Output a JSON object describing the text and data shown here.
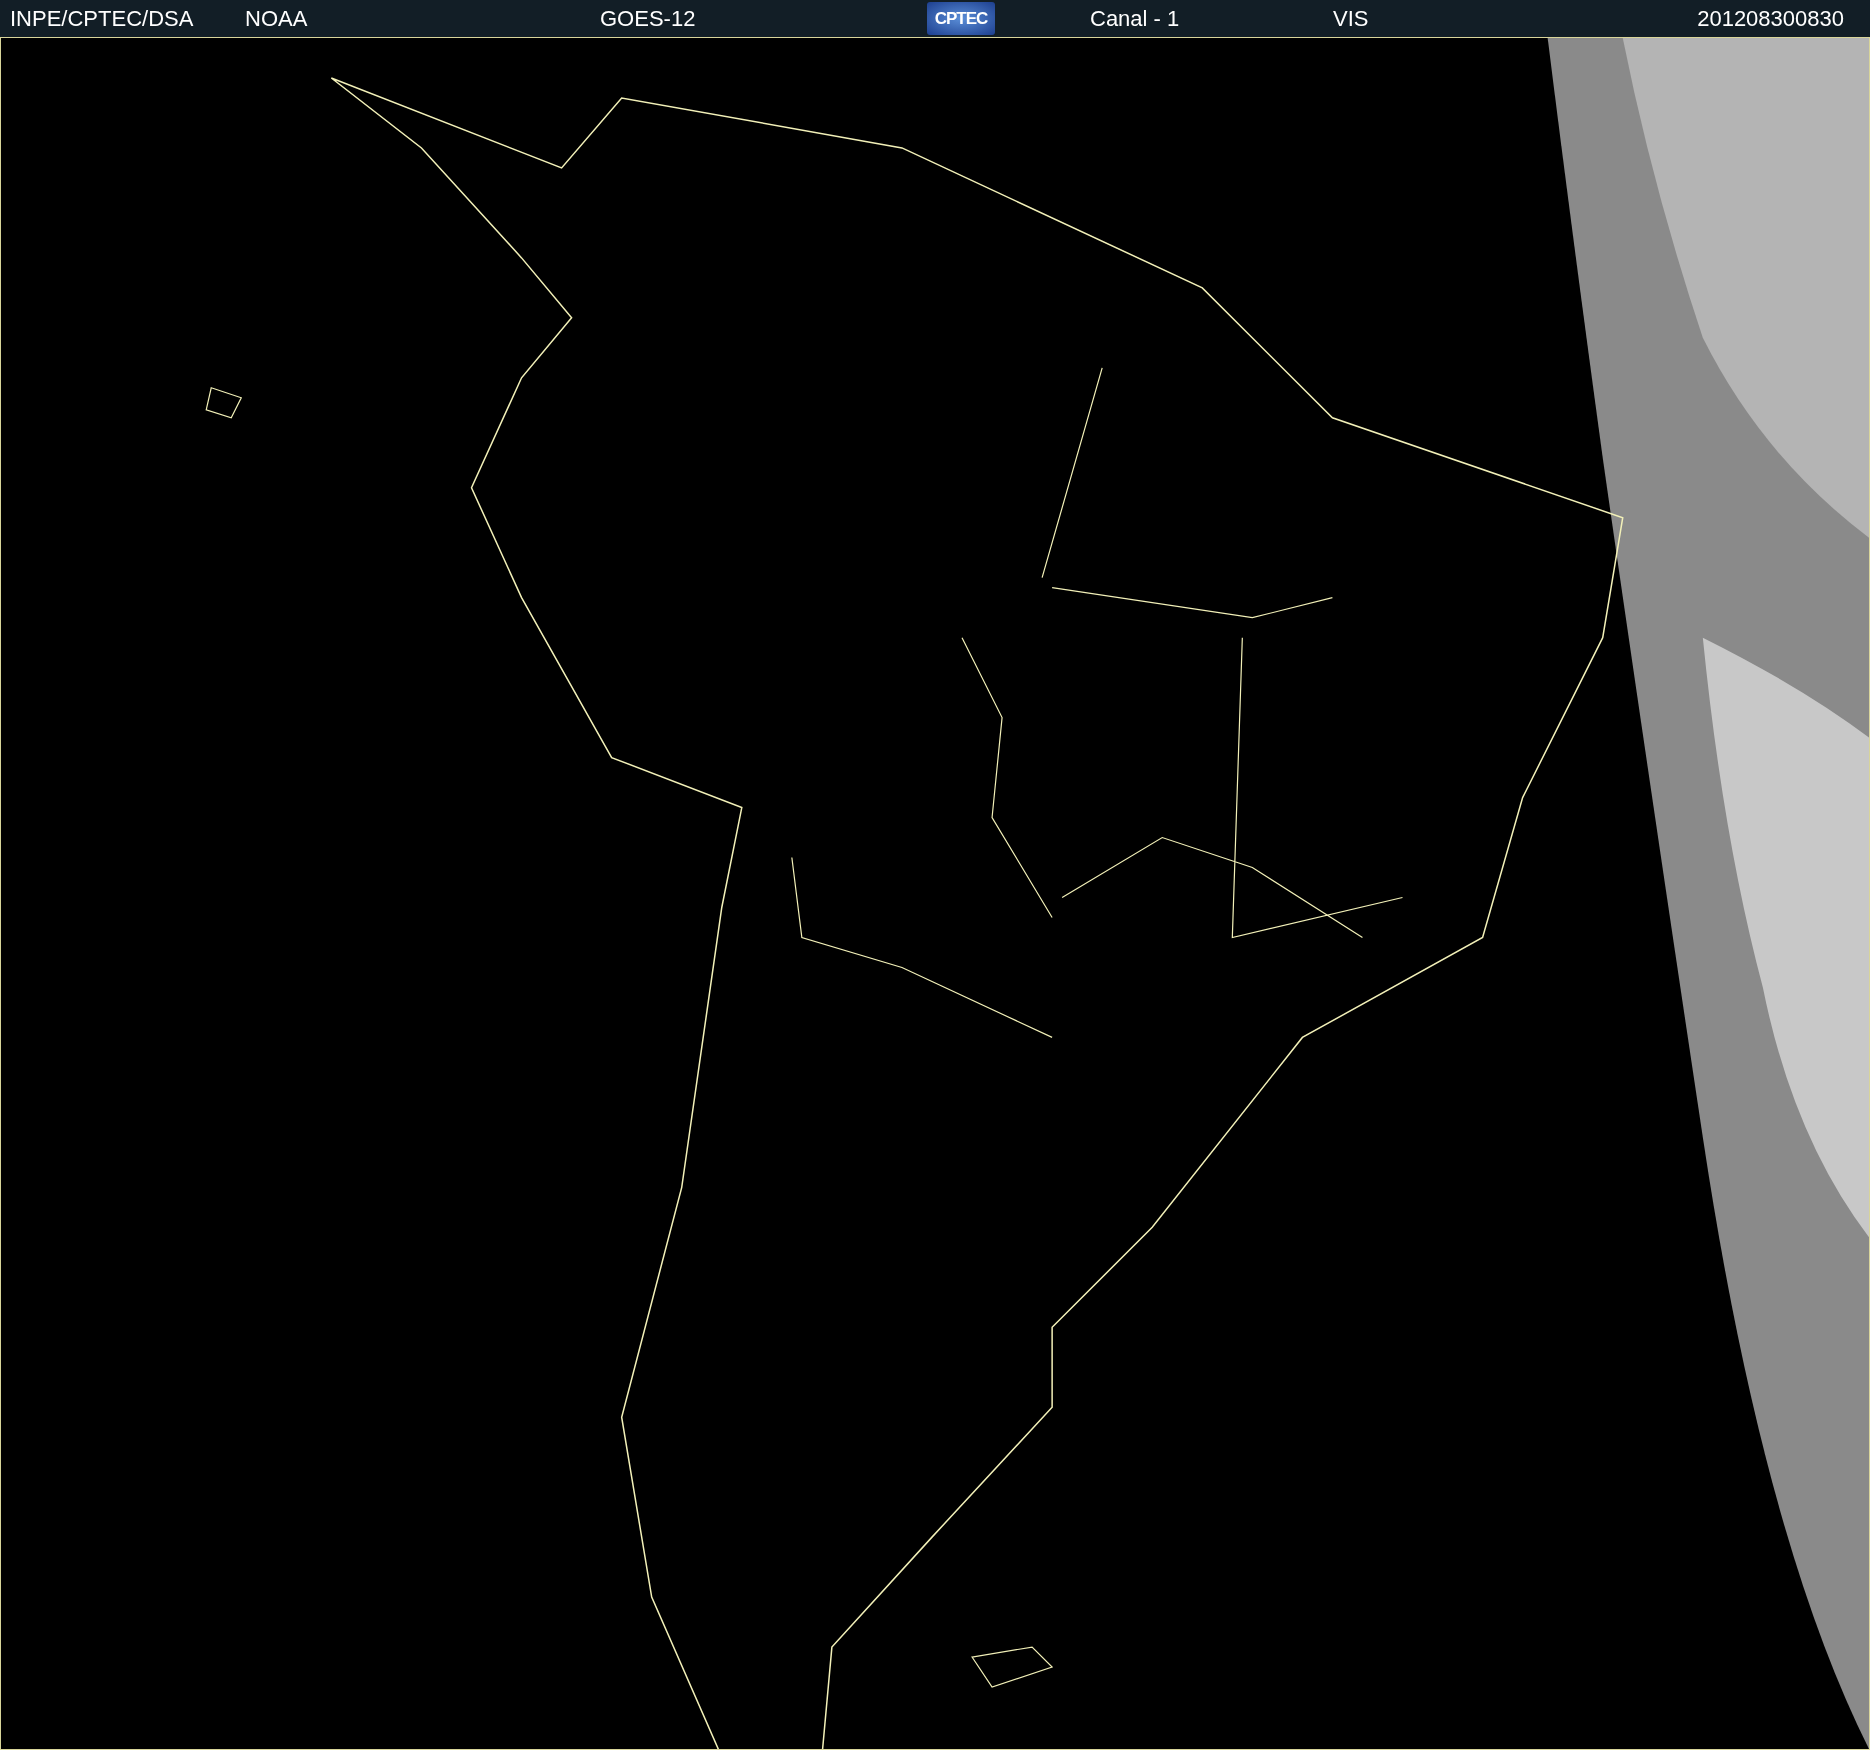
{
  "header": {
    "source": "INPE/CPTEC/DSA",
    "agency": "NOAA",
    "satellite": "GOES-12",
    "logo": "CPTEC",
    "channel": "Canal - 1",
    "band": "VIS",
    "timestamp": "201208300830"
  }
}
